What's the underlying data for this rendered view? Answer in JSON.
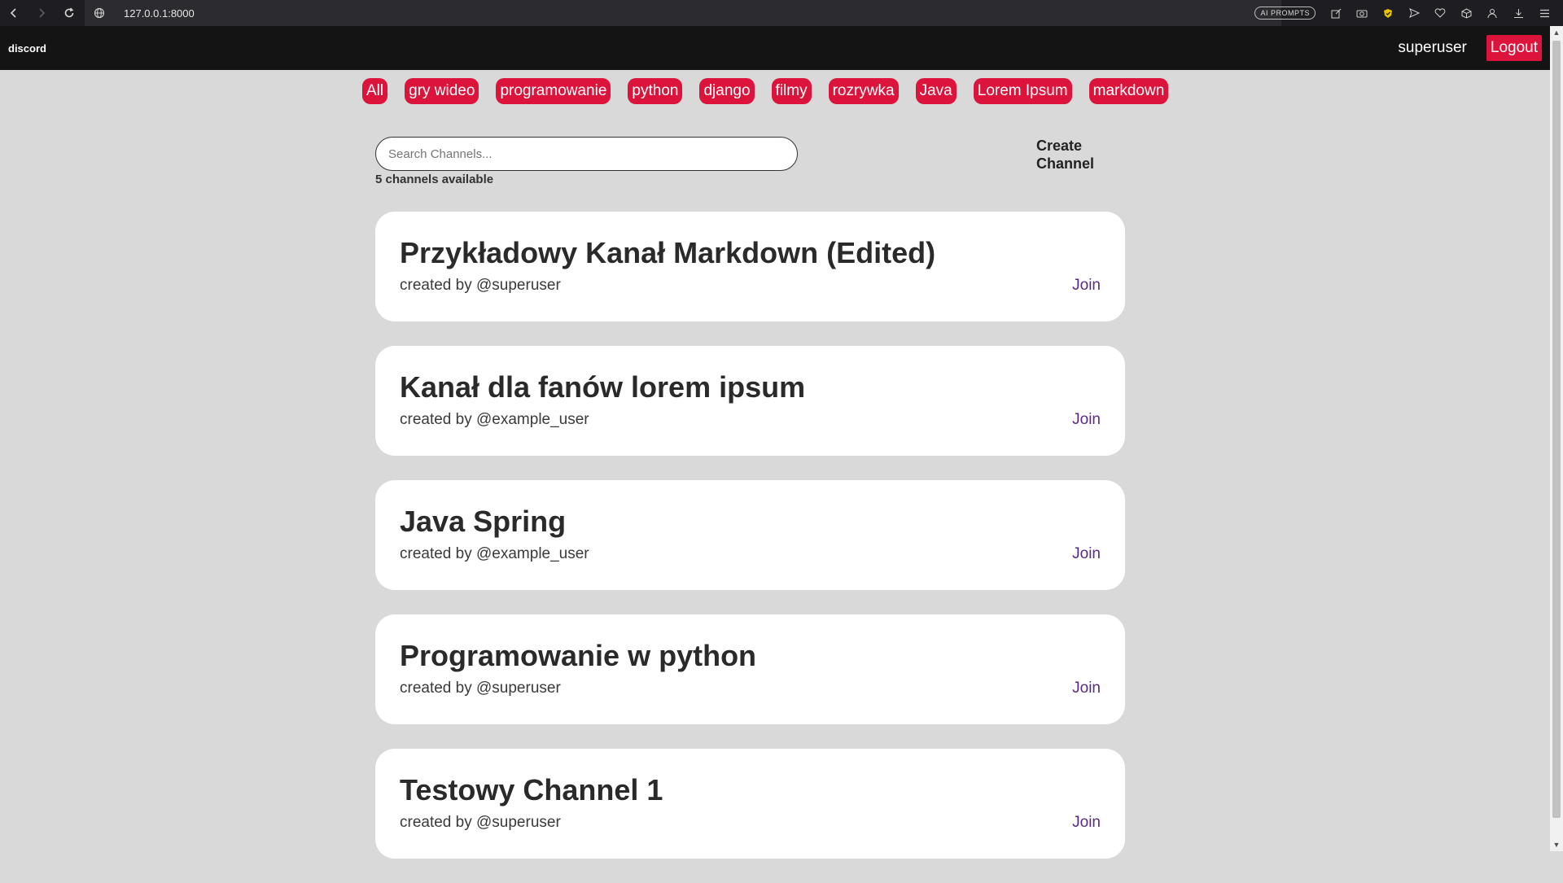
{
  "browser": {
    "url": "127.0.0.1:8000",
    "ai_prompts_label": "AI PROMPTS"
  },
  "header": {
    "logo": "discord",
    "username": "superuser",
    "logout_label": "Logout"
  },
  "topics": [
    "All",
    "gry wideo",
    "programowanie",
    "python",
    "django",
    "filmy",
    "rozrywka",
    "Java",
    "Lorem Ipsum",
    "markdown"
  ],
  "search": {
    "placeholder": "Search Channels...",
    "count_text": "5 channels available",
    "create_label": "Create Channel"
  },
  "channels": [
    {
      "title": "Przykładowy Kanał Markdown (Edited)",
      "meta": "created by @superuser",
      "join": "Join"
    },
    {
      "title": "Kanał dla fanów lorem ipsum",
      "meta": "created by @example_user",
      "join": "Join"
    },
    {
      "title": "Java Spring",
      "meta": "created by @example_user",
      "join": "Join"
    },
    {
      "title": "Programowanie w python",
      "meta": "created by @superuser",
      "join": "Join"
    },
    {
      "title": "Testowy Channel 1",
      "meta": "created by @superuser",
      "join": "Join"
    }
  ],
  "colors": {
    "accent": "#dc143c",
    "header_bg": "#141414",
    "page_bg": "#d9d9d9",
    "link": "#5b2a86"
  }
}
